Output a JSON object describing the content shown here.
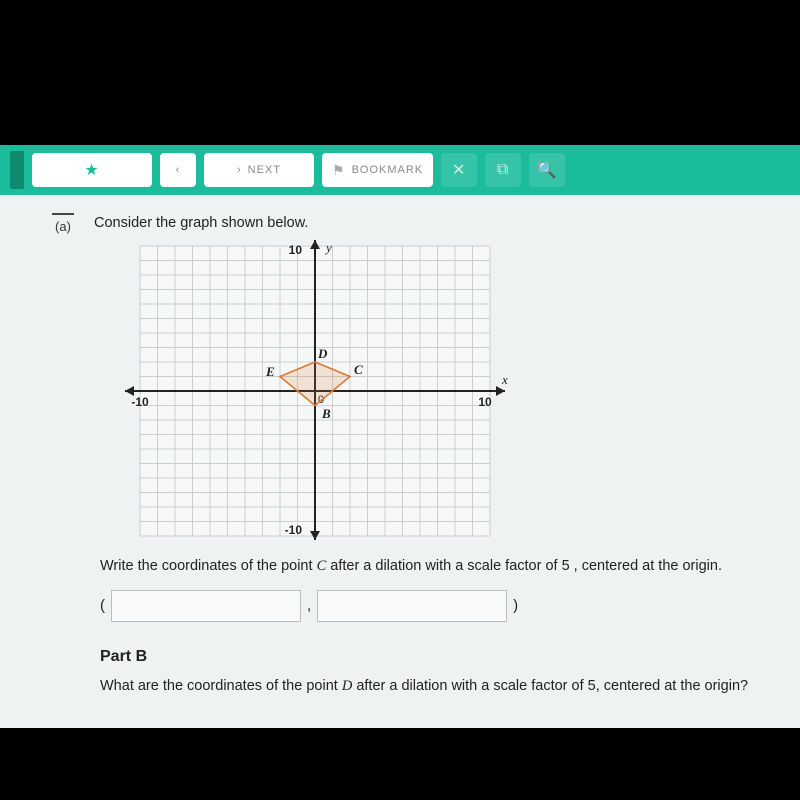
{
  "toolbar": {
    "next_label": "NEXT",
    "bookmark_label": "BOOKMARK"
  },
  "question": {
    "part_label": "(a)",
    "prompt": "Consider the graph shown below.",
    "instruction_pre": "Write the coordinates of the point ",
    "instruction_point": "C",
    "instruction_post": " after a dilation with a scale factor of 5 , centered at the origin.",
    "paren_open": "(",
    "comma": ",",
    "paren_close": ")",
    "part_b_title": "Part B",
    "part_b_pre": "What are the coordinates of the point ",
    "part_b_point": "D",
    "part_b_post": " after a dilation with a scale factor of 5, centered at the origin?"
  },
  "chart_data": {
    "type": "scatter",
    "title": "",
    "xlabel": "x",
    "ylabel": "y",
    "xlim": [
      -10,
      10
    ],
    "ylim": [
      -10,
      10
    ],
    "grid": true,
    "tick_labels": {
      "x": [
        -10,
        10
      ],
      "y": [
        -10,
        10
      ]
    },
    "points": [
      {
        "name": "B",
        "x": 0,
        "y": -1
      },
      {
        "name": "C",
        "x": 2,
        "y": 1
      },
      {
        "name": "D",
        "x": 0,
        "y": 2
      },
      {
        "name": "E",
        "x": -2,
        "y": 1
      }
    ],
    "shape": "rhombus",
    "shape_vertices_order": [
      "B",
      "C",
      "D",
      "E"
    ],
    "shape_stroke": "#d97a3a",
    "shape_fill": "rgba(217,122,58,0.18)"
  }
}
